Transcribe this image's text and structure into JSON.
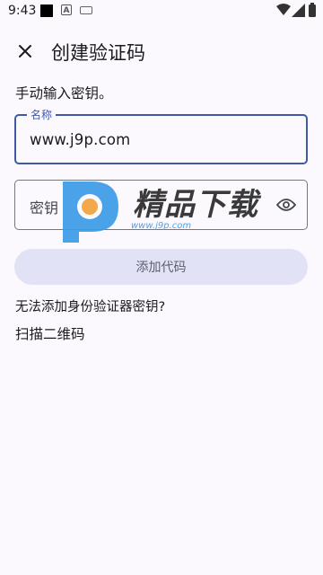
{
  "status_bar": {
    "time": "9:43",
    "notification_icons": [
      "square-icon",
      "a-icon",
      "keyboard-icon"
    ],
    "system_icons": [
      "wifi-icon",
      "signal-icon",
      "battery-icon"
    ]
  },
  "app_bar": {
    "close_icon": "close-icon",
    "title": "创建验证码"
  },
  "instruction": "手动输入密钥。",
  "name_field": {
    "label": "名称",
    "value": "www.j9p.com"
  },
  "key_field": {
    "placeholder": "密钥",
    "visibility_icon": "eye-icon"
  },
  "add_button_label": "添加代码",
  "no_key_text": "无法添加身份验证器密钥?",
  "scan_label": "扫描二维码",
  "watermark": {
    "brand": "精品下载",
    "url": "www.j9p.com",
    "accent_color": "#3c9be8"
  },
  "colors": {
    "primary": "#3f5aa9",
    "background": "#fbf8fe",
    "button_bg": "#e1e2f5"
  }
}
